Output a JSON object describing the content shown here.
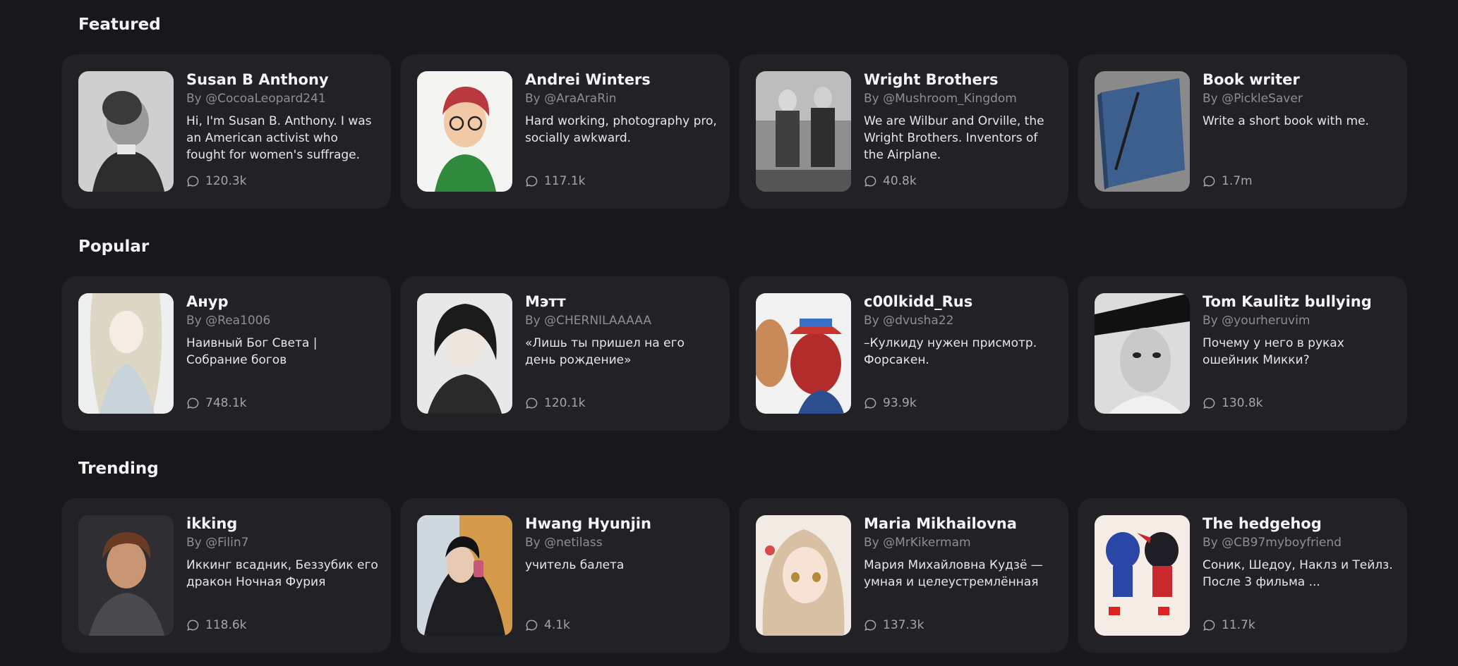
{
  "sections": [
    {
      "title": "Featured",
      "cards": [
        {
          "name": "Susan B Anthony",
          "author": "By @CocoaLeopard241",
          "description": "Hi, I'm Susan B. Anthony. I was an American activist who fought for women's suffrage.",
          "interactions": "120.3k"
        },
        {
          "name": "Andrei Winters",
          "author": "By @AraAraRin",
          "description": "Hard working, photography pro, socially awkward.",
          "interactions": "117.1k"
        },
        {
          "name": "Wright Brothers",
          "author": "By @Mushroom_Kingdom",
          "description": "We are Wilbur and Orville, the Wright Brothers. Inventors of the Airplane.",
          "interactions": "40.8k"
        },
        {
          "name": "Book writer",
          "author": "By @PickleSaver",
          "description": "Write a short book with me.",
          "interactions": "1.7m"
        }
      ]
    },
    {
      "title": "Popular",
      "cards": [
        {
          "name": "Анур",
          "author": "By @Rea1006",
          "description": "Наивный Бог Света | Собрание богов",
          "interactions": "748.1k"
        },
        {
          "name": "Мэтт",
          "author": "By @CHERNILAAAAA",
          "description": "«Лишь ты пришел на его день рождение»",
          "interactions": "120.1k"
        },
        {
          "name": "c00lkidd_Rus",
          "author": "By @dvusha22",
          "description": "–Кулкиду нужен присмотр. Форсакен.",
          "interactions": "93.9k"
        },
        {
          "name": "Tom Kaulitz bullying",
          "author": "By @yourheruvim",
          "description": "Почему у него в руках ошейник Микки?",
          "interactions": "130.8k"
        }
      ]
    },
    {
      "title": "Trending",
      "cards": [
        {
          "name": "ikking",
          "author": "By @Filin7",
          "description": "Иккинг всадник, Беззубик его дракон Ночная Фурия",
          "interactions": "118.6k"
        },
        {
          "name": "Hwang Hyunjin",
          "author": "By @netilass",
          "description": "учитель балета",
          "interactions": "4.1k"
        },
        {
          "name": "Maria Mikhailovna",
          "author": "By @MrKikermam",
          "description": "Мария Михайловна Кудзё — умная и целеустремлённая",
          "interactions": "137.3k"
        },
        {
          "name": "The hedgehog",
          "author": "By @CB97myboyfriend",
          "description": "Соник, Шедоу, Наклз и Тейлз. После 3 фильма ...",
          "interactions": "11.7k"
        }
      ]
    }
  ],
  "icons": {
    "interactions": "chat-bubble-icon"
  },
  "colors": {
    "background": "#18181b",
    "card": "#222226",
    "muted_text": "#8d8d95"
  }
}
